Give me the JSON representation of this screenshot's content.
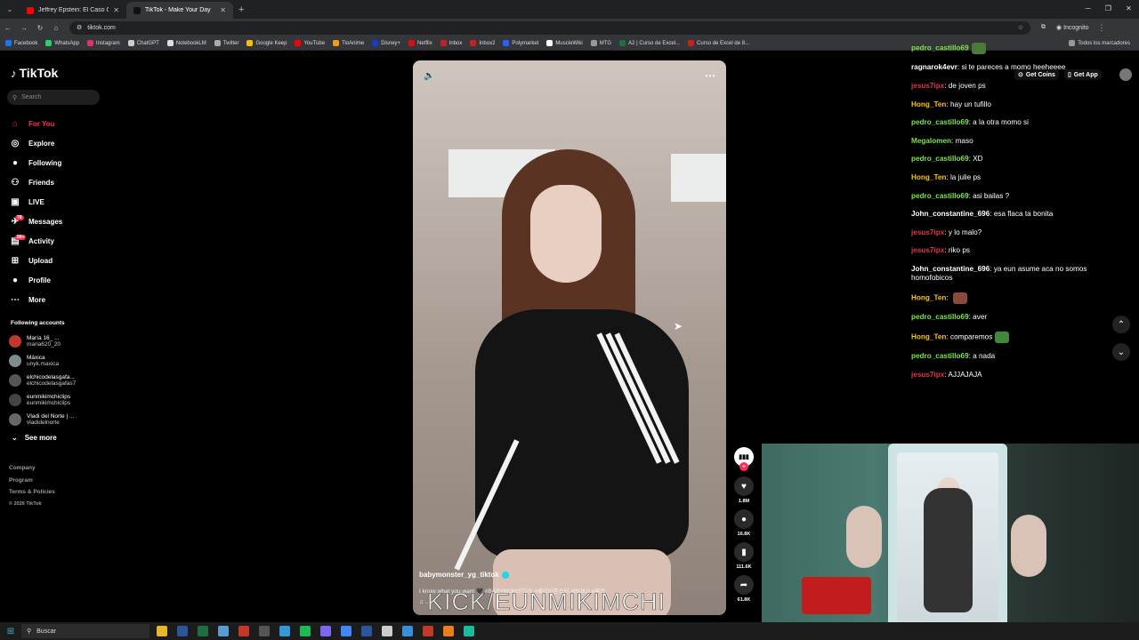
{
  "browser": {
    "tabs": [
      {
        "title": "Jeffrey Epstein: El Caso Que El...",
        "favicon_color": "#ff0000",
        "active": false
      },
      {
        "title": "TikTok - Make Your Day",
        "favicon_color": "#111111",
        "active": true
      }
    ],
    "url": "tiktok.com",
    "incognito_label": "Incognito",
    "bookmarks": [
      {
        "label": "Facebook",
        "color": "#1877f2"
      },
      {
        "label": "WhatsApp",
        "color": "#25d366"
      },
      {
        "label": "Instagram",
        "color": "#e1306c"
      },
      {
        "label": "ChatGPT",
        "color": "#cccccc"
      },
      {
        "label": "NotebookLM",
        "color": "#dddddd"
      },
      {
        "label": "Twitter",
        "color": "#aaaaaa"
      },
      {
        "label": "Google Keep",
        "color": "#fbbc04"
      },
      {
        "label": "YouTube",
        "color": "#ff0000"
      },
      {
        "label": "TioAnime",
        "color": "#f39c12"
      },
      {
        "label": "Disney+",
        "color": "#113ccf"
      },
      {
        "label": "Netflix",
        "color": "#e50914"
      },
      {
        "label": "Inbox",
        "color": "#c5221f"
      },
      {
        "label": "Inbox2",
        "color": "#c5221f"
      },
      {
        "label": "Polymarket",
        "color": "#2e5cff"
      },
      {
        "label": "MuscleWiki",
        "color": "#ffffff"
      },
      {
        "label": "MTG",
        "color": "#999999"
      },
      {
        "label": "A2 | Curso de Excel...",
        "color": "#1d6f42"
      },
      {
        "label": "Curso de Excel de 8...",
        "color": "#c5221f"
      }
    ],
    "all_bookmarks": "Todos los marcadores"
  },
  "sidebar": {
    "logo": "TikTok",
    "search_placeholder": "Search",
    "nav": [
      {
        "label": "For You",
        "icon": "home-icon",
        "glyph": "⌂",
        "active": true
      },
      {
        "label": "Explore",
        "icon": "compass-icon",
        "glyph": "◎",
        "active": false
      },
      {
        "label": "Following",
        "icon": "following-avatar-icon",
        "glyph": "●",
        "active": false
      },
      {
        "label": "Friends",
        "icon": "friends-icon",
        "glyph": "⚇",
        "active": false
      },
      {
        "label": "LIVE",
        "icon": "live-icon",
        "glyph": "▣",
        "active": false
      },
      {
        "label": "Messages",
        "icon": "messages-icon",
        "glyph": "✈",
        "active": false,
        "badge": "78"
      },
      {
        "label": "Activity",
        "icon": "activity-icon",
        "glyph": "▤",
        "active": false,
        "badge": "99+"
      },
      {
        "label": "Upload",
        "icon": "upload-icon",
        "glyph": "⊞",
        "active": false
      },
      {
        "label": "Profile",
        "icon": "profile-avatar-icon",
        "glyph": "●",
        "active": false
      },
      {
        "label": "More",
        "icon": "more-icon",
        "glyph": "⋯",
        "active": false
      }
    ],
    "following_title": "Following accounts",
    "following": [
      {
        "name": "María 16_ ...",
        "user": "maria620_20",
        "color": "#c0392b"
      },
      {
        "name": "Máxica",
        "user": "unyk.maxica",
        "color": "#7f8c8d"
      },
      {
        "name": "elchicodelasgafa...",
        "user": "elchicodelasgafas7",
        "color": "#555555"
      },
      {
        "name": "eunmikimchiclips",
        "user": "eunmikimchiclips",
        "color": "#444444"
      },
      {
        "name": "Vladi del Norte | ...",
        "user": "vladidelnorte",
        "color": "#666666"
      }
    ],
    "see_more": "See more",
    "footer": [
      "Company",
      "Program",
      "Terms & Policies"
    ],
    "copyright": "© 2026 TikTok"
  },
  "video": {
    "author": "babymonster_yg_tiktok",
    "description": "I know what you want 🖤 #BABYMONSTER #베이비몬스터 #RUKA #루카",
    "music": "♫ ...",
    "watermark": "KICK/EUNMIKIMCHI"
  },
  "actions": [
    {
      "name": "like",
      "icon": "heart-icon",
      "glyph": "♥",
      "count": "1.8M"
    },
    {
      "name": "comment",
      "icon": "comment-icon",
      "glyph": "●",
      "count": "16.8K"
    },
    {
      "name": "save",
      "icon": "bookmark-icon",
      "glyph": "▮",
      "count": "111.6K"
    },
    {
      "name": "share",
      "icon": "share-icon",
      "glyph": "➦",
      "count": "61.8K"
    }
  ],
  "topright": {
    "coins": "Get Coins",
    "app": "Get App"
  },
  "chat": [
    {
      "user": "pedro_castillo69",
      "color": "#7ee34b",
      "text": "",
      "emote": "#4a7a3a"
    },
    {
      "user": "ragnarok4evr",
      "color": "#ffffff",
      "text": ": si te pareces a momo heeheeee"
    },
    {
      "user": "jesus7ipx",
      "color": "#e0364a",
      "text": ": de joven ps"
    },
    {
      "user": "Hong_Ten",
      "color": "#f5c518",
      "text": ": hay un tufillo"
    },
    {
      "user": "pedro_castillo69",
      "color": "#7ee34b",
      "text": ": a la otra momo si"
    },
    {
      "user": "Megalomen",
      "color": "#7ee34b",
      "text": ": maso"
    },
    {
      "user": "pedro_castillo69",
      "color": "#7ee34b",
      "text": ": XD"
    },
    {
      "user": "Hong_Ten",
      "color": "#f5c518",
      "text": ": la julie ps"
    },
    {
      "user": "pedro_castillo69",
      "color": "#7ee34b",
      "text": ": asi bailas ?"
    },
    {
      "user": "John_constantine_696",
      "color": "#ffffff",
      "text": ": esa flaca ta bonita"
    },
    {
      "user": "jesus7ipx",
      "color": "#e0364a",
      "text": ": y lo malo?"
    },
    {
      "user": "jesus7ipx",
      "color": "#e0364a",
      "text": ": riko ps"
    },
    {
      "user": "John_constantine_696",
      "color": "#ffffff",
      "text": ": ya eun asume aca no somos homofobicos"
    },
    {
      "user": "Hong_Ten",
      "color": "#f5c518",
      "text": ": ",
      "emote": "#8a4a3a"
    },
    {
      "user": "pedro_castillo69",
      "color": "#7ee34b",
      "text": ": aver"
    },
    {
      "user": "Hong_Ten",
      "color": "#f5c518",
      "text": ": comparemos",
      "emote": "#3f8a3a"
    },
    {
      "user": "pedro_castillo69",
      "color": "#7ee34b",
      "text": ": a nada"
    },
    {
      "user": "jesus7ipx",
      "color": "#e0364a",
      "text": ": AJJAJAJA"
    }
  ],
  "taskbar": {
    "search_label": "Buscar",
    "apps": [
      "#e8b62a",
      "#2b579a",
      "#1d6f42",
      "#5a9bd5",
      "#c0392b",
      "#555555",
      "#3498db",
      "#1db954",
      "#7b68ee",
      "#4285f4",
      "#2b579a",
      "#cccccc",
      "#3a8fd6",
      "#c0392b",
      "#e67e22",
      "#1abc9c"
    ]
  }
}
